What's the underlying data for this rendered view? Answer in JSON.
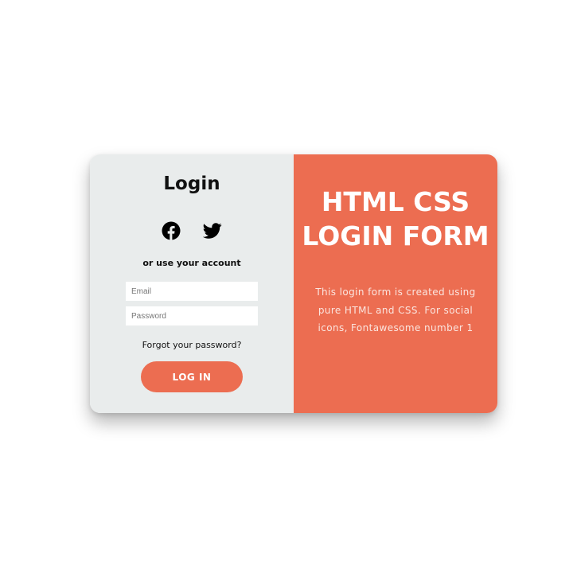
{
  "login_panel": {
    "title": "Login",
    "social_icons": [
      "facebook-icon",
      "twitter-icon"
    ],
    "alt_text": "or use your account",
    "email_placeholder": "Email",
    "email_value": "",
    "password_placeholder": "Password",
    "password_value": "",
    "forgot_link": "Forgot your password?",
    "submit_label": "LOG IN"
  },
  "info_panel": {
    "title_line1": "HTML CSS",
    "title_line2": "LOGIN FORM",
    "desc_line1": "This login form is created using",
    "desc_line2": "pure HTML and CSS. For social",
    "desc_line3": "icons, Fontawesome number 1"
  },
  "colors": {
    "accent": "#ec6d51",
    "left_panel_bg": "#e9ecec",
    "text_dark": "#111111",
    "white": "#ffffff"
  }
}
